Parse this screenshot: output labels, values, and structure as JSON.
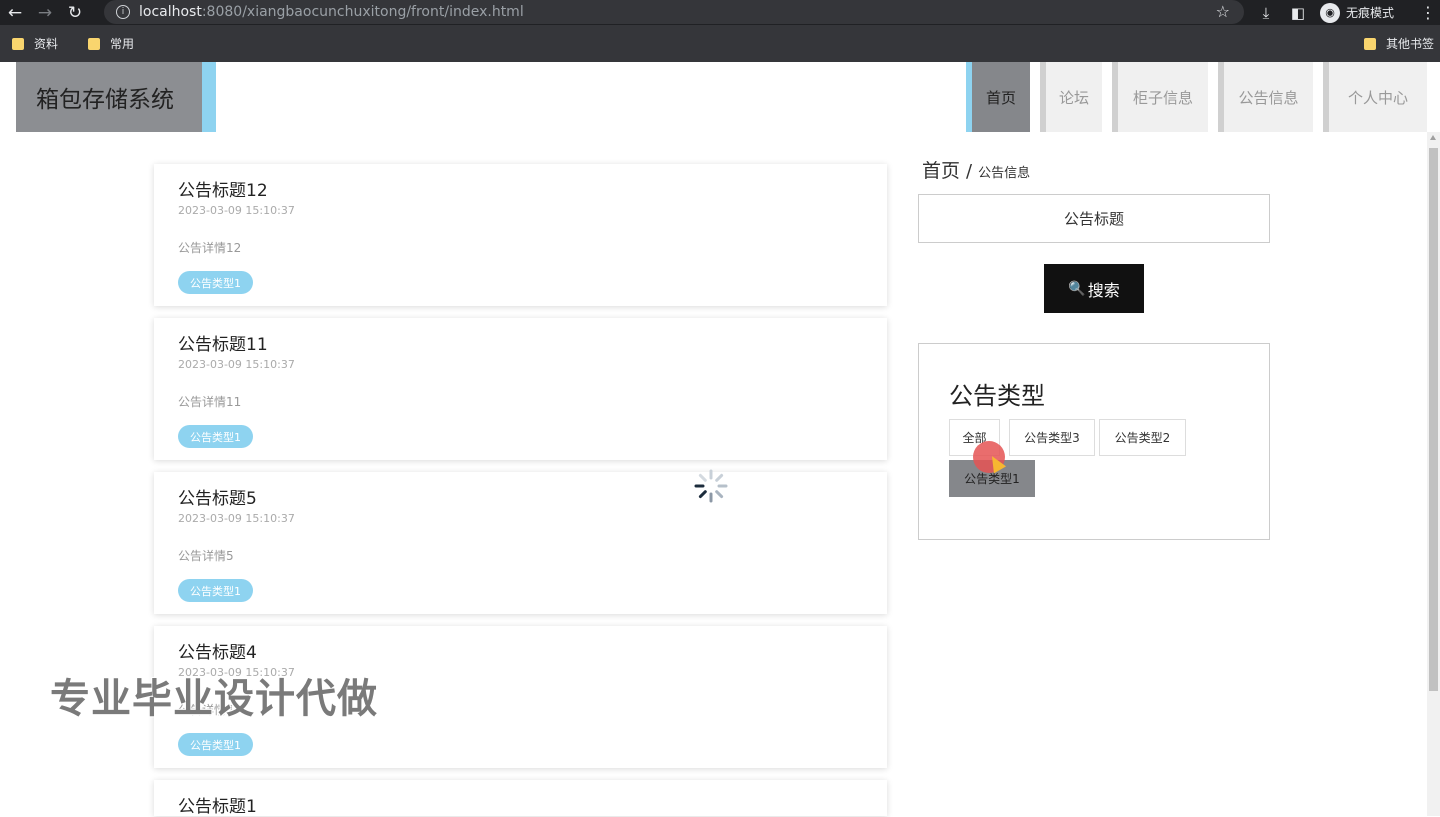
{
  "browser": {
    "url_host": "localhost",
    "url_rest": ":8080/xiangbaocunchuxitong/front/index.html",
    "incognito_label": "无痕模式",
    "bookmarks": [
      "资料",
      "常用"
    ],
    "other_bookmarks": "其他书签"
  },
  "header": {
    "logo": "箱包存储系统",
    "nav": [
      "首页",
      "论坛",
      "柜子信息",
      "公告信息",
      "个人中心"
    ]
  },
  "notices": [
    {
      "title": "公告标题12",
      "time": "2023-03-09 15:10:37",
      "desc": "公告详情12",
      "tag": "公告类型1"
    },
    {
      "title": "公告标题11",
      "time": "2023-03-09 15:10:37",
      "desc": "公告详情11",
      "tag": "公告类型1"
    },
    {
      "title": "公告标题5",
      "time": "2023-03-09 15:10:37",
      "desc": "公告详情5",
      "tag": "公告类型1"
    },
    {
      "title": "公告标题4",
      "time": "2023-03-09 15:10:37",
      "desc": "公告详情4",
      "tag": "公告类型1"
    },
    {
      "title": "公告标题1"
    }
  ],
  "breadcrumb": {
    "home": "首页",
    "sep": "/",
    "current": "公告信息"
  },
  "search": {
    "value": "公告标题",
    "button": "搜索"
  },
  "categories": {
    "title": "公告类型",
    "items": [
      "全部",
      "公告类型3",
      "公告类型2",
      "公告类型1"
    ],
    "selected": "公告类型1"
  },
  "watermark": "专业毕业设计代做",
  "colors": {
    "accent": "#8ed3f0",
    "active_nav": "#85878b",
    "button": "#111111"
  }
}
